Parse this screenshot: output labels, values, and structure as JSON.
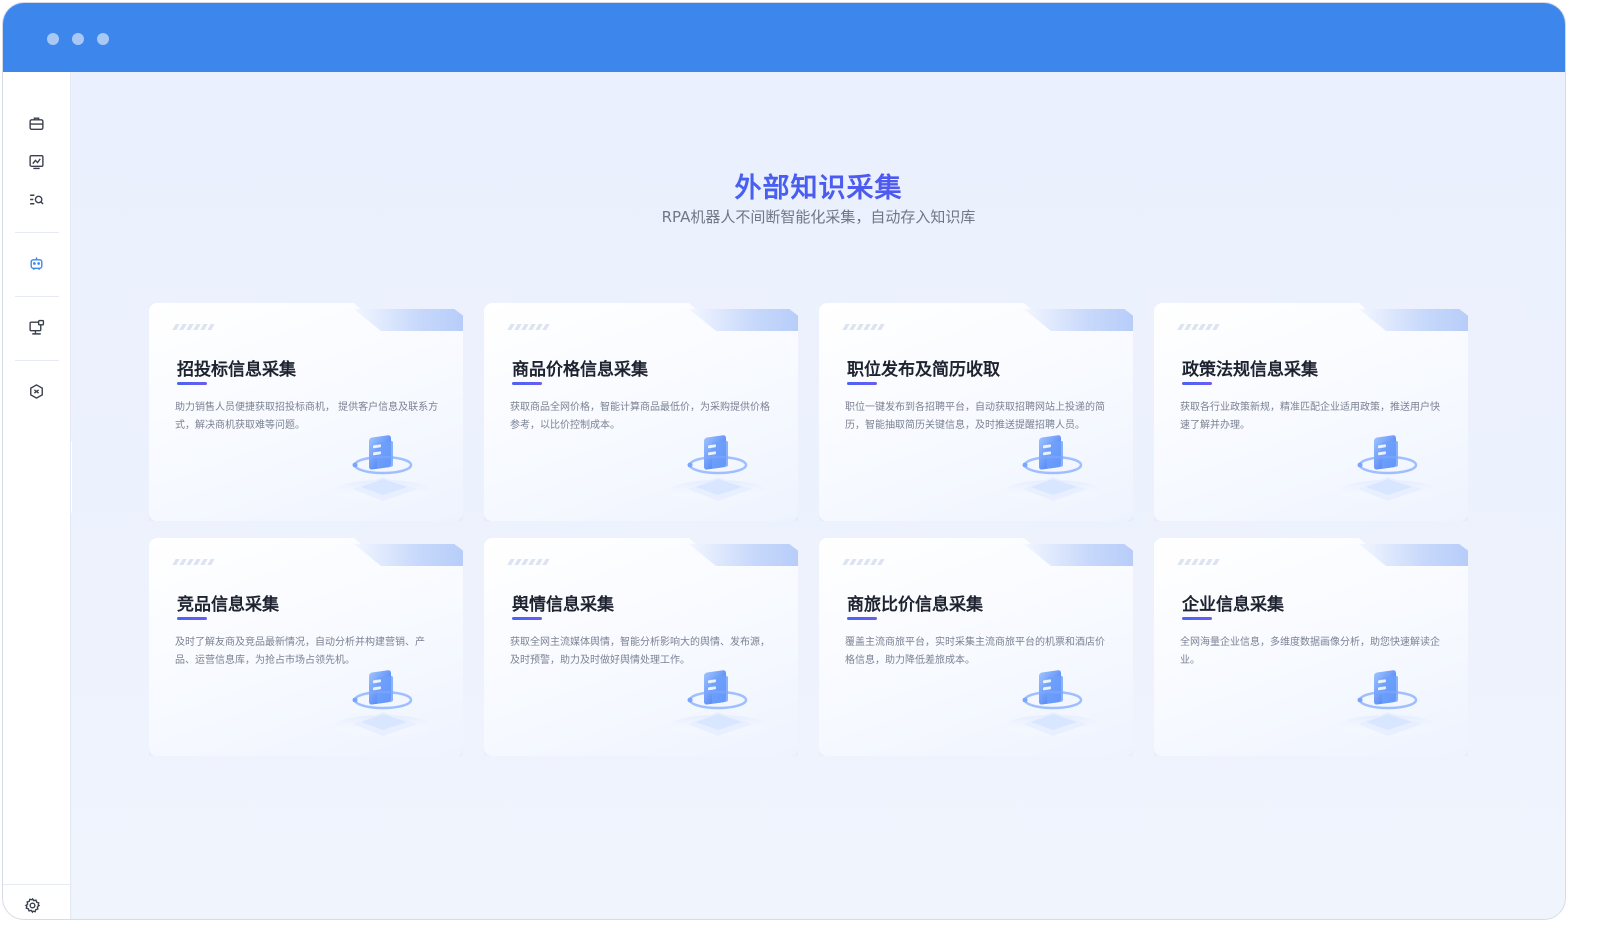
{
  "window": {
    "traffic_lights": [
      "dot-1",
      "dot-2",
      "dot-3"
    ]
  },
  "sidebar": {
    "items": [
      {
        "name": "briefcase-icon"
      },
      {
        "name": "chart-icon"
      },
      {
        "name": "search-list-icon"
      },
      {
        "name": "robot-icon",
        "active": true
      },
      {
        "name": "monitor-icon"
      },
      {
        "name": "hexagon-icon"
      }
    ],
    "settings_icon": "gear-icon",
    "collapse_icon": "chevron-right-icon"
  },
  "header": {
    "title": "外部知识采集",
    "subtitle": "RPA机器人不间断智能化采集，自动存入知识库"
  },
  "cards": [
    {
      "title": "招投标信息采集",
      "desc": "助力销售人员便捷获取招投标商机， 提供客户信息及联系方式，解决商机获取难等问题。"
    },
    {
      "title": "商品价格信息采集",
      "desc": "获取商品全网价格，智能计算商品最低价，为采购提供价格参考，以比价控制成本。"
    },
    {
      "title": "职位发布及简历收取",
      "desc": "职位一键发布到各招聘平台，自动获取招聘网站上投递的简历，智能抽取简历关键信息，及时推送提醒招聘人员。"
    },
    {
      "title": "政策法规信息采集",
      "desc": "获取各行业政策新规，精准匹配企业适用政策，推送用户快速了解并办理。"
    },
    {
      "title": "竞品信息采集",
      "desc": "及时了解友商及竞品最新情况，自动分析并构建营销、产品、运营信息库，为抢占市场占领先机。"
    },
    {
      "title": "舆情信息采集",
      "desc": "获取全网主流媒体舆情，智能分析影响大的舆情、发布源，及时预警，助力及时做好舆情处理工作。"
    },
    {
      "title": "商旅比价信息采集",
      "desc": "覆盖主流商旅平台，实时采集主流商旅平台的机票和酒店价格信息，助力降低差旅成本。"
    },
    {
      "title": "企业信息采集",
      "desc": "全网海量企业信息，多维度数据画像分析，助您快速解读企业。"
    }
  ],
  "colors": {
    "titlebar": "#3d86ec",
    "accent": "#4a63f2",
    "active_icon": "#3d86ec"
  }
}
